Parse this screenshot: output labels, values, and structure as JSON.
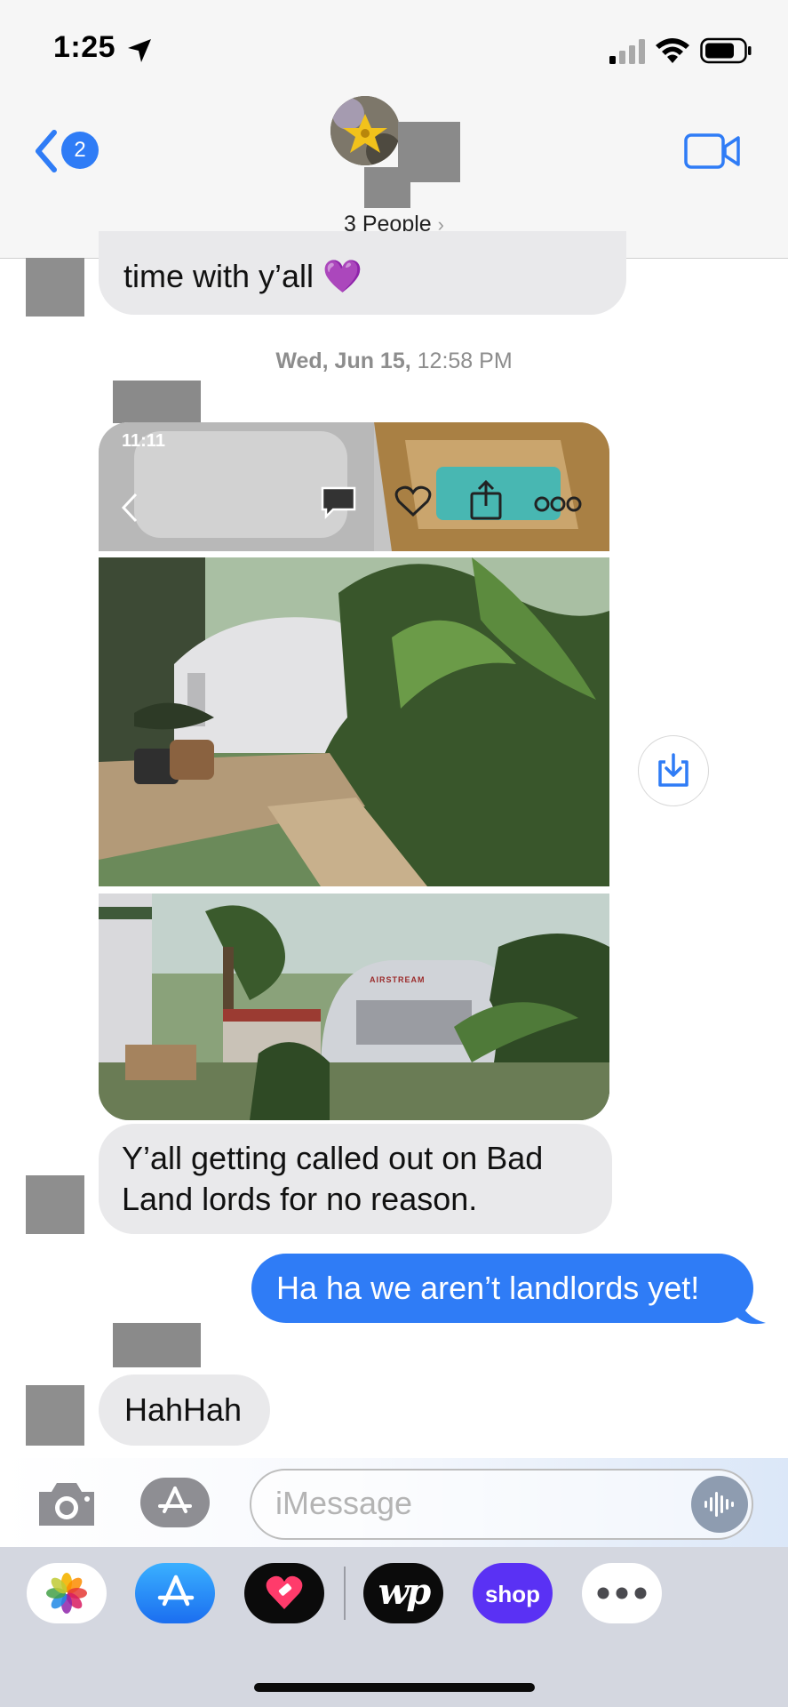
{
  "status_bar": {
    "time": "1:25"
  },
  "header": {
    "back_badge": "2",
    "group_title": "3 People",
    "chevron": "›"
  },
  "messages": {
    "prev_text": "time with y’all 💜",
    "timestamp_day": "Wed, Jun 15,",
    "timestamp_time": "12:58 PM",
    "photo_status_time": "11:11",
    "incoming_1": "Y’all getting called out on Bad Land lords for no reason.",
    "outgoing_1": "Ha ha we aren’t landlords yet!",
    "incoming_2": "HahHah",
    "photo_sign_text": "AIRSTREAM"
  },
  "composer": {
    "placeholder": "iMessage"
  },
  "app_drawer": {
    "items": [
      "photos-app",
      "app-store-app",
      "heart-app",
      "washington-post-app",
      "shop-app",
      "more-apps"
    ],
    "wp_label": "wp",
    "shop_label": "shop"
  },
  "colors": {
    "accent": "#2f7cf6",
    "incoming_bubble": "#e9e9eb",
    "header_bg": "#f6f6f6",
    "shop": "#5a31f4"
  },
  "icons": {
    "location": "location-arrow-icon",
    "video": "video-camera-icon",
    "download": "download-icon",
    "camera": "camera-icon",
    "apps": "app-store-icon",
    "audio": "waveform-icon"
  }
}
